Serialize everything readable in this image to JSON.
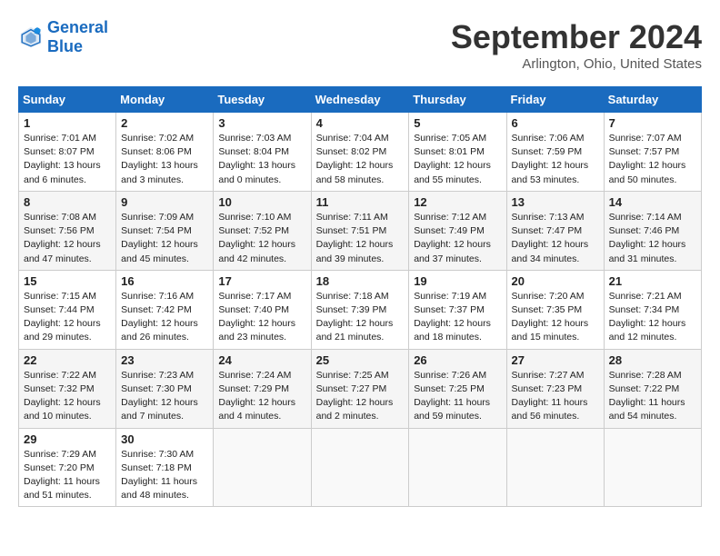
{
  "header": {
    "logo_line1": "General",
    "logo_line2": "Blue",
    "month": "September 2024",
    "location": "Arlington, Ohio, United States"
  },
  "weekdays": [
    "Sunday",
    "Monday",
    "Tuesday",
    "Wednesday",
    "Thursday",
    "Friday",
    "Saturday"
  ],
  "weeks": [
    [
      {
        "day": "1",
        "sunrise": "Sunrise: 7:01 AM",
        "sunset": "Sunset: 8:07 PM",
        "daylight": "Daylight: 13 hours and 6 minutes."
      },
      {
        "day": "2",
        "sunrise": "Sunrise: 7:02 AM",
        "sunset": "Sunset: 8:06 PM",
        "daylight": "Daylight: 13 hours and 3 minutes."
      },
      {
        "day": "3",
        "sunrise": "Sunrise: 7:03 AM",
        "sunset": "Sunset: 8:04 PM",
        "daylight": "Daylight: 13 hours and 0 minutes."
      },
      {
        "day": "4",
        "sunrise": "Sunrise: 7:04 AM",
        "sunset": "Sunset: 8:02 PM",
        "daylight": "Daylight: 12 hours and 58 minutes."
      },
      {
        "day": "5",
        "sunrise": "Sunrise: 7:05 AM",
        "sunset": "Sunset: 8:01 PM",
        "daylight": "Daylight: 12 hours and 55 minutes."
      },
      {
        "day": "6",
        "sunrise": "Sunrise: 7:06 AM",
        "sunset": "Sunset: 7:59 PM",
        "daylight": "Daylight: 12 hours and 53 minutes."
      },
      {
        "day": "7",
        "sunrise": "Sunrise: 7:07 AM",
        "sunset": "Sunset: 7:57 PM",
        "daylight": "Daylight: 12 hours and 50 minutes."
      }
    ],
    [
      {
        "day": "8",
        "sunrise": "Sunrise: 7:08 AM",
        "sunset": "Sunset: 7:56 PM",
        "daylight": "Daylight: 12 hours and 47 minutes."
      },
      {
        "day": "9",
        "sunrise": "Sunrise: 7:09 AM",
        "sunset": "Sunset: 7:54 PM",
        "daylight": "Daylight: 12 hours and 45 minutes."
      },
      {
        "day": "10",
        "sunrise": "Sunrise: 7:10 AM",
        "sunset": "Sunset: 7:52 PM",
        "daylight": "Daylight: 12 hours and 42 minutes."
      },
      {
        "day": "11",
        "sunrise": "Sunrise: 7:11 AM",
        "sunset": "Sunset: 7:51 PM",
        "daylight": "Daylight: 12 hours and 39 minutes."
      },
      {
        "day": "12",
        "sunrise": "Sunrise: 7:12 AM",
        "sunset": "Sunset: 7:49 PM",
        "daylight": "Daylight: 12 hours and 37 minutes."
      },
      {
        "day": "13",
        "sunrise": "Sunrise: 7:13 AM",
        "sunset": "Sunset: 7:47 PM",
        "daylight": "Daylight: 12 hours and 34 minutes."
      },
      {
        "day": "14",
        "sunrise": "Sunrise: 7:14 AM",
        "sunset": "Sunset: 7:46 PM",
        "daylight": "Daylight: 12 hours and 31 minutes."
      }
    ],
    [
      {
        "day": "15",
        "sunrise": "Sunrise: 7:15 AM",
        "sunset": "Sunset: 7:44 PM",
        "daylight": "Daylight: 12 hours and 29 minutes."
      },
      {
        "day": "16",
        "sunrise": "Sunrise: 7:16 AM",
        "sunset": "Sunset: 7:42 PM",
        "daylight": "Daylight: 12 hours and 26 minutes."
      },
      {
        "day": "17",
        "sunrise": "Sunrise: 7:17 AM",
        "sunset": "Sunset: 7:40 PM",
        "daylight": "Daylight: 12 hours and 23 minutes."
      },
      {
        "day": "18",
        "sunrise": "Sunrise: 7:18 AM",
        "sunset": "Sunset: 7:39 PM",
        "daylight": "Daylight: 12 hours and 21 minutes."
      },
      {
        "day": "19",
        "sunrise": "Sunrise: 7:19 AM",
        "sunset": "Sunset: 7:37 PM",
        "daylight": "Daylight: 12 hours and 18 minutes."
      },
      {
        "day": "20",
        "sunrise": "Sunrise: 7:20 AM",
        "sunset": "Sunset: 7:35 PM",
        "daylight": "Daylight: 12 hours and 15 minutes."
      },
      {
        "day": "21",
        "sunrise": "Sunrise: 7:21 AM",
        "sunset": "Sunset: 7:34 PM",
        "daylight": "Daylight: 12 hours and 12 minutes."
      }
    ],
    [
      {
        "day": "22",
        "sunrise": "Sunrise: 7:22 AM",
        "sunset": "Sunset: 7:32 PM",
        "daylight": "Daylight: 12 hours and 10 minutes."
      },
      {
        "day": "23",
        "sunrise": "Sunrise: 7:23 AM",
        "sunset": "Sunset: 7:30 PM",
        "daylight": "Daylight: 12 hours and 7 minutes."
      },
      {
        "day": "24",
        "sunrise": "Sunrise: 7:24 AM",
        "sunset": "Sunset: 7:29 PM",
        "daylight": "Daylight: 12 hours and 4 minutes."
      },
      {
        "day": "25",
        "sunrise": "Sunrise: 7:25 AM",
        "sunset": "Sunset: 7:27 PM",
        "daylight": "Daylight: 12 hours and 2 minutes."
      },
      {
        "day": "26",
        "sunrise": "Sunrise: 7:26 AM",
        "sunset": "Sunset: 7:25 PM",
        "daylight": "Daylight: 11 hours and 59 minutes."
      },
      {
        "day": "27",
        "sunrise": "Sunrise: 7:27 AM",
        "sunset": "Sunset: 7:23 PM",
        "daylight": "Daylight: 11 hours and 56 minutes."
      },
      {
        "day": "28",
        "sunrise": "Sunrise: 7:28 AM",
        "sunset": "Sunset: 7:22 PM",
        "daylight": "Daylight: 11 hours and 54 minutes."
      }
    ],
    [
      {
        "day": "29",
        "sunrise": "Sunrise: 7:29 AM",
        "sunset": "Sunset: 7:20 PM",
        "daylight": "Daylight: 11 hours and 51 minutes."
      },
      {
        "day": "30",
        "sunrise": "Sunrise: 7:30 AM",
        "sunset": "Sunset: 7:18 PM",
        "daylight": "Daylight: 11 hours and 48 minutes."
      },
      null,
      null,
      null,
      null,
      null
    ]
  ]
}
